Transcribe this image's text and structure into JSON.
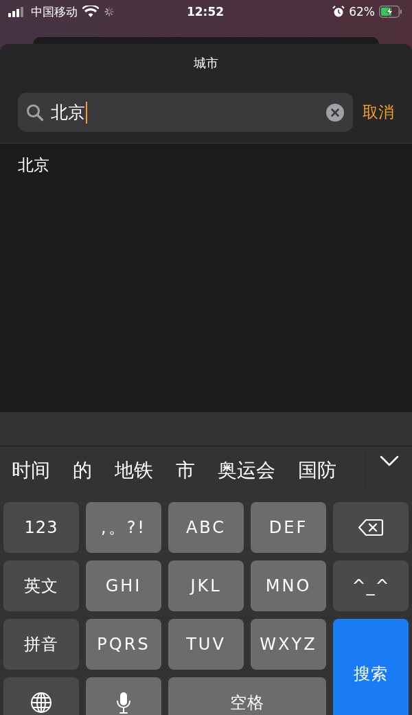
{
  "status_bar": {
    "carrier": "中国移动",
    "time": "12:52",
    "battery_percent": "62%",
    "battery": {
      "charging": true
    }
  },
  "sheet": {
    "title": "城市"
  },
  "search": {
    "value": "北京",
    "cancel": "取消"
  },
  "results": [
    {
      "label": "北京"
    }
  ],
  "keyboard": {
    "candidates": [
      "时间",
      "的",
      "地铁",
      "市",
      "奥运会",
      "国防"
    ],
    "keys": [
      {
        "kind": "function",
        "label": "123"
      },
      {
        "kind": "letter",
        "label": ",。?!"
      },
      {
        "kind": "letter",
        "label": "ABC"
      },
      {
        "kind": "letter",
        "label": "DEF"
      },
      {
        "kind": "backspace"
      },
      {
        "kind": "function",
        "label": "英文"
      },
      {
        "kind": "letter",
        "label": "GHI"
      },
      {
        "kind": "letter",
        "label": "JKL"
      },
      {
        "kind": "letter",
        "label": "MNO"
      },
      {
        "kind": "function",
        "label": "^_^"
      },
      {
        "kind": "function",
        "label": "拼音"
      },
      {
        "kind": "letter",
        "label": "PQRS"
      },
      {
        "kind": "letter",
        "label": "TUV"
      },
      {
        "kind": "letter",
        "label": "WXYZ"
      },
      {
        "kind": "action",
        "label": "搜索"
      },
      {
        "kind": "globe"
      },
      {
        "kind": "mic"
      },
      {
        "kind": "space",
        "label": "空格"
      }
    ]
  }
}
